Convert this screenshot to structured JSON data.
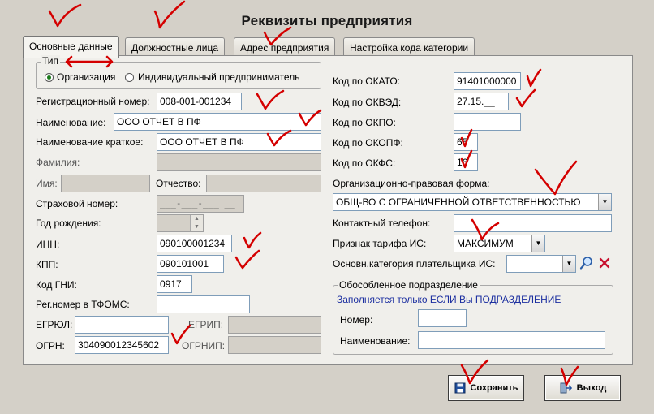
{
  "window": {
    "title": "Реквизиты предприятия"
  },
  "tabs": [
    {
      "label": "Основные данные",
      "active": true
    },
    {
      "label": "Должностные лица"
    },
    {
      "label": "Адрес предприятия"
    },
    {
      "label": "Настройка кода категории"
    }
  ],
  "type_group": {
    "legend": "Тип",
    "options": [
      {
        "label": "Организация",
        "selected": true
      },
      {
        "label": "Индивидуальный предприниматель",
        "selected": false
      }
    ]
  },
  "left": {
    "reg_number": {
      "label": "Регистрационный номер:",
      "value": "008-001-001234"
    },
    "name": {
      "label": "Наименование:",
      "value": "ООО ОТЧЕТ В ПФ"
    },
    "short_name": {
      "label": "Наименование краткое:",
      "value": "ООО ОТЧЕТ В ПФ"
    },
    "surname": {
      "label": "Фамилия:",
      "value": ""
    },
    "first_name": {
      "label": "Имя:",
      "value": ""
    },
    "patronymic": {
      "label": "Отчество:",
      "value": ""
    },
    "insurance_no": {
      "label": "Страховой номер:",
      "value": "___-___-___ __"
    },
    "birth_year": {
      "label": "Год рождения:",
      "value": ""
    },
    "inn": {
      "label": "ИНН:",
      "value": "090100001234"
    },
    "kpp": {
      "label": "КПП:",
      "value": "090101001"
    },
    "gni_code": {
      "label": "Код ГНИ:",
      "value": "0917"
    },
    "tfoms_reg": {
      "label": "Рег.номер в ТФОМС:",
      "value": ""
    },
    "egrul": {
      "label": "ЕГРЮЛ:",
      "value": ""
    },
    "egrip": {
      "label": "ЕГРИП:",
      "value": ""
    },
    "ogrn": {
      "label": "ОГРН:",
      "value": "304090012345602"
    },
    "ogrnip": {
      "label": "ОГРНИП:",
      "value": ""
    }
  },
  "right": {
    "okato": {
      "label": "Код по ОКАТО:",
      "value": "91401000000"
    },
    "okved": {
      "label": "Код по ОКВЭД:",
      "value": "27.15.__"
    },
    "okpo": {
      "label": "Код по ОКПО:",
      "value": ""
    },
    "okopf": {
      "label": "Код по ОКОПФ:",
      "value": "65"
    },
    "okfs": {
      "label": "Код по ОКФС:",
      "value": "16"
    },
    "legal_form": {
      "label": "Организационно-правовая форма:",
      "value": "ОБЩ-ВО С ОГРАНИЧЕННОЙ ОТВЕТСТВЕННОСТЬЮ"
    },
    "phone": {
      "label": "Контактный телефон:",
      "value": ""
    },
    "tariff": {
      "label": "Признак тарифа ИС:",
      "value": "МАКСИМУМ"
    },
    "payer_category": {
      "label": "Основн.категория плательщика ИС:",
      "value": ""
    }
  },
  "branch": {
    "legend": "Обособленное подразделение",
    "note": "Заполняется только ЕСЛИ Вы ПОДРАЗДЕЛЕНИЕ",
    "number": {
      "label": "Номер:",
      "value": ""
    },
    "name": {
      "label": "Наименование:",
      "value": ""
    }
  },
  "buttons": {
    "save": "Сохранить",
    "exit": "Выход"
  },
  "icons": {
    "search": "magnifier-icon",
    "clear": "red-x-icon",
    "save": "floppy-disk-icon",
    "exit": "exit-door-icon"
  },
  "colors": {
    "annotation": "#d40000",
    "note_text": "#1c2fa0",
    "radio_dot": "#1a7a1a"
  }
}
